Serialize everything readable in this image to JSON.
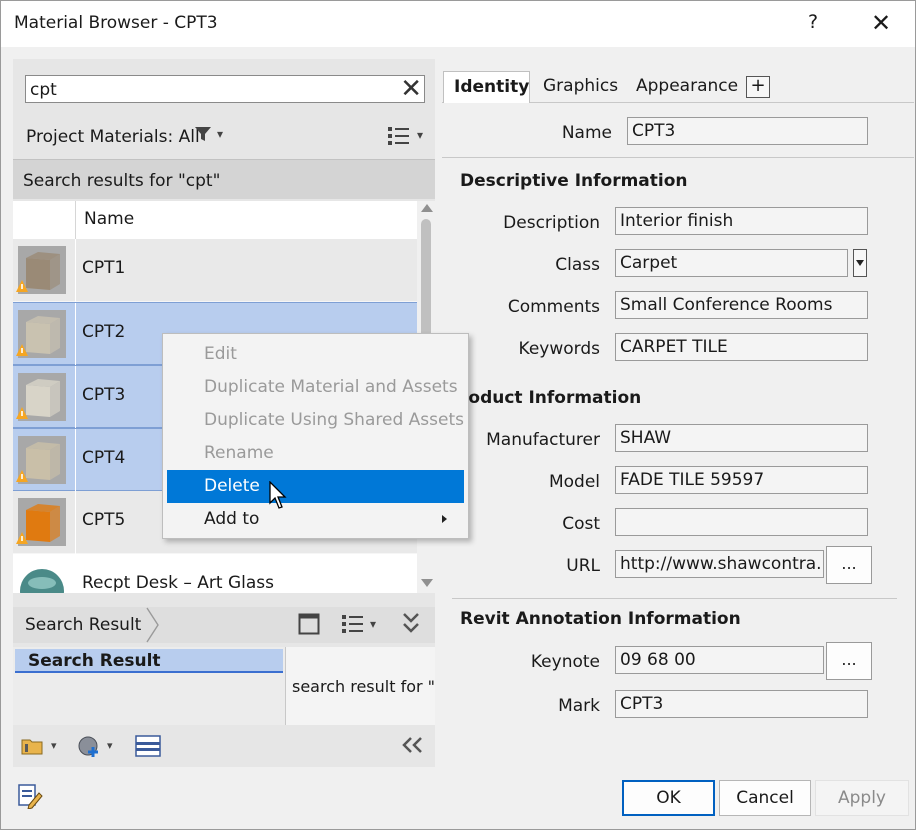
{
  "window": {
    "title": "Material Browser - CPT3",
    "help_glyph": "?",
    "close_glyph": "✕"
  },
  "search": {
    "value": "cpt",
    "clear_glyph": "✕"
  },
  "filter": {
    "label": "Project Materials: All"
  },
  "results": {
    "header": "Search results for \"cpt\"",
    "column_name": "Name"
  },
  "materials": [
    {
      "name": "CPT1",
      "selected": false,
      "color": "#9a8a76"
    },
    {
      "name": "CPT2",
      "selected": true,
      "color": "#c9c2b0"
    },
    {
      "name": "CPT3",
      "selected": true,
      "color": "#d8d4c8"
    },
    {
      "name": "CPT4",
      "selected": true,
      "color": "#c9bfa8"
    },
    {
      "name": "CPT5",
      "selected": false,
      "color": "#e07a10"
    },
    {
      "name": "Recpt Desk – Art Glass",
      "selected": false,
      "color": "#4a8a88"
    }
  ],
  "library": {
    "bar_label": "Search Result",
    "tree_item": "Search Result",
    "detail_text": "search result for \"c"
  },
  "tabs": [
    {
      "label": "Identity",
      "active": true
    },
    {
      "label": "Graphics",
      "active": false
    },
    {
      "label": "Appearance",
      "active": false
    }
  ],
  "tab_add": "+",
  "identity": {
    "name_label": "Name",
    "name_value": "CPT3",
    "descriptive_heading": "Descriptive Information",
    "description_label": "Description",
    "description_value": "Interior finish",
    "class_label": "Class",
    "class_value": "Carpet",
    "comments_label": "Comments",
    "comments_value": "Small Conference Rooms",
    "keywords_label": "Keywords",
    "keywords_value": "CARPET TILE",
    "product_heading": "roduct Information",
    "manufacturer_label": "Manufacturer",
    "manufacturer_value": "SHAW",
    "model_label": "Model",
    "model_value": "FADE TILE 59597",
    "cost_label": "Cost",
    "cost_value": "",
    "url_label": "URL",
    "url_value": "http://www.shawcontra...",
    "url_button": "...",
    "revit_heading": "Revit Annotation Information",
    "keynote_label": "Keynote",
    "keynote_value": "09 68 00",
    "keynote_button": "...",
    "mark_label": "Mark",
    "mark_value": "CPT3"
  },
  "context_menu": {
    "items": [
      {
        "label": "Edit",
        "state": "disabled"
      },
      {
        "label": "Duplicate Material and Assets",
        "state": "disabled"
      },
      {
        "label": "Duplicate Using Shared Assets",
        "state": "disabled"
      },
      {
        "label": "Rename",
        "state": "disabled"
      },
      {
        "label": "Delete",
        "state": "highlighted"
      },
      {
        "label": "Add to",
        "state": "submenu"
      }
    ]
  },
  "footer": {
    "ok": "OK",
    "cancel": "Cancel",
    "apply": "Apply"
  },
  "colors": {
    "selection": "#b8cdee",
    "menu_highlight": "#0078d7",
    "warning": "#f5a623"
  }
}
